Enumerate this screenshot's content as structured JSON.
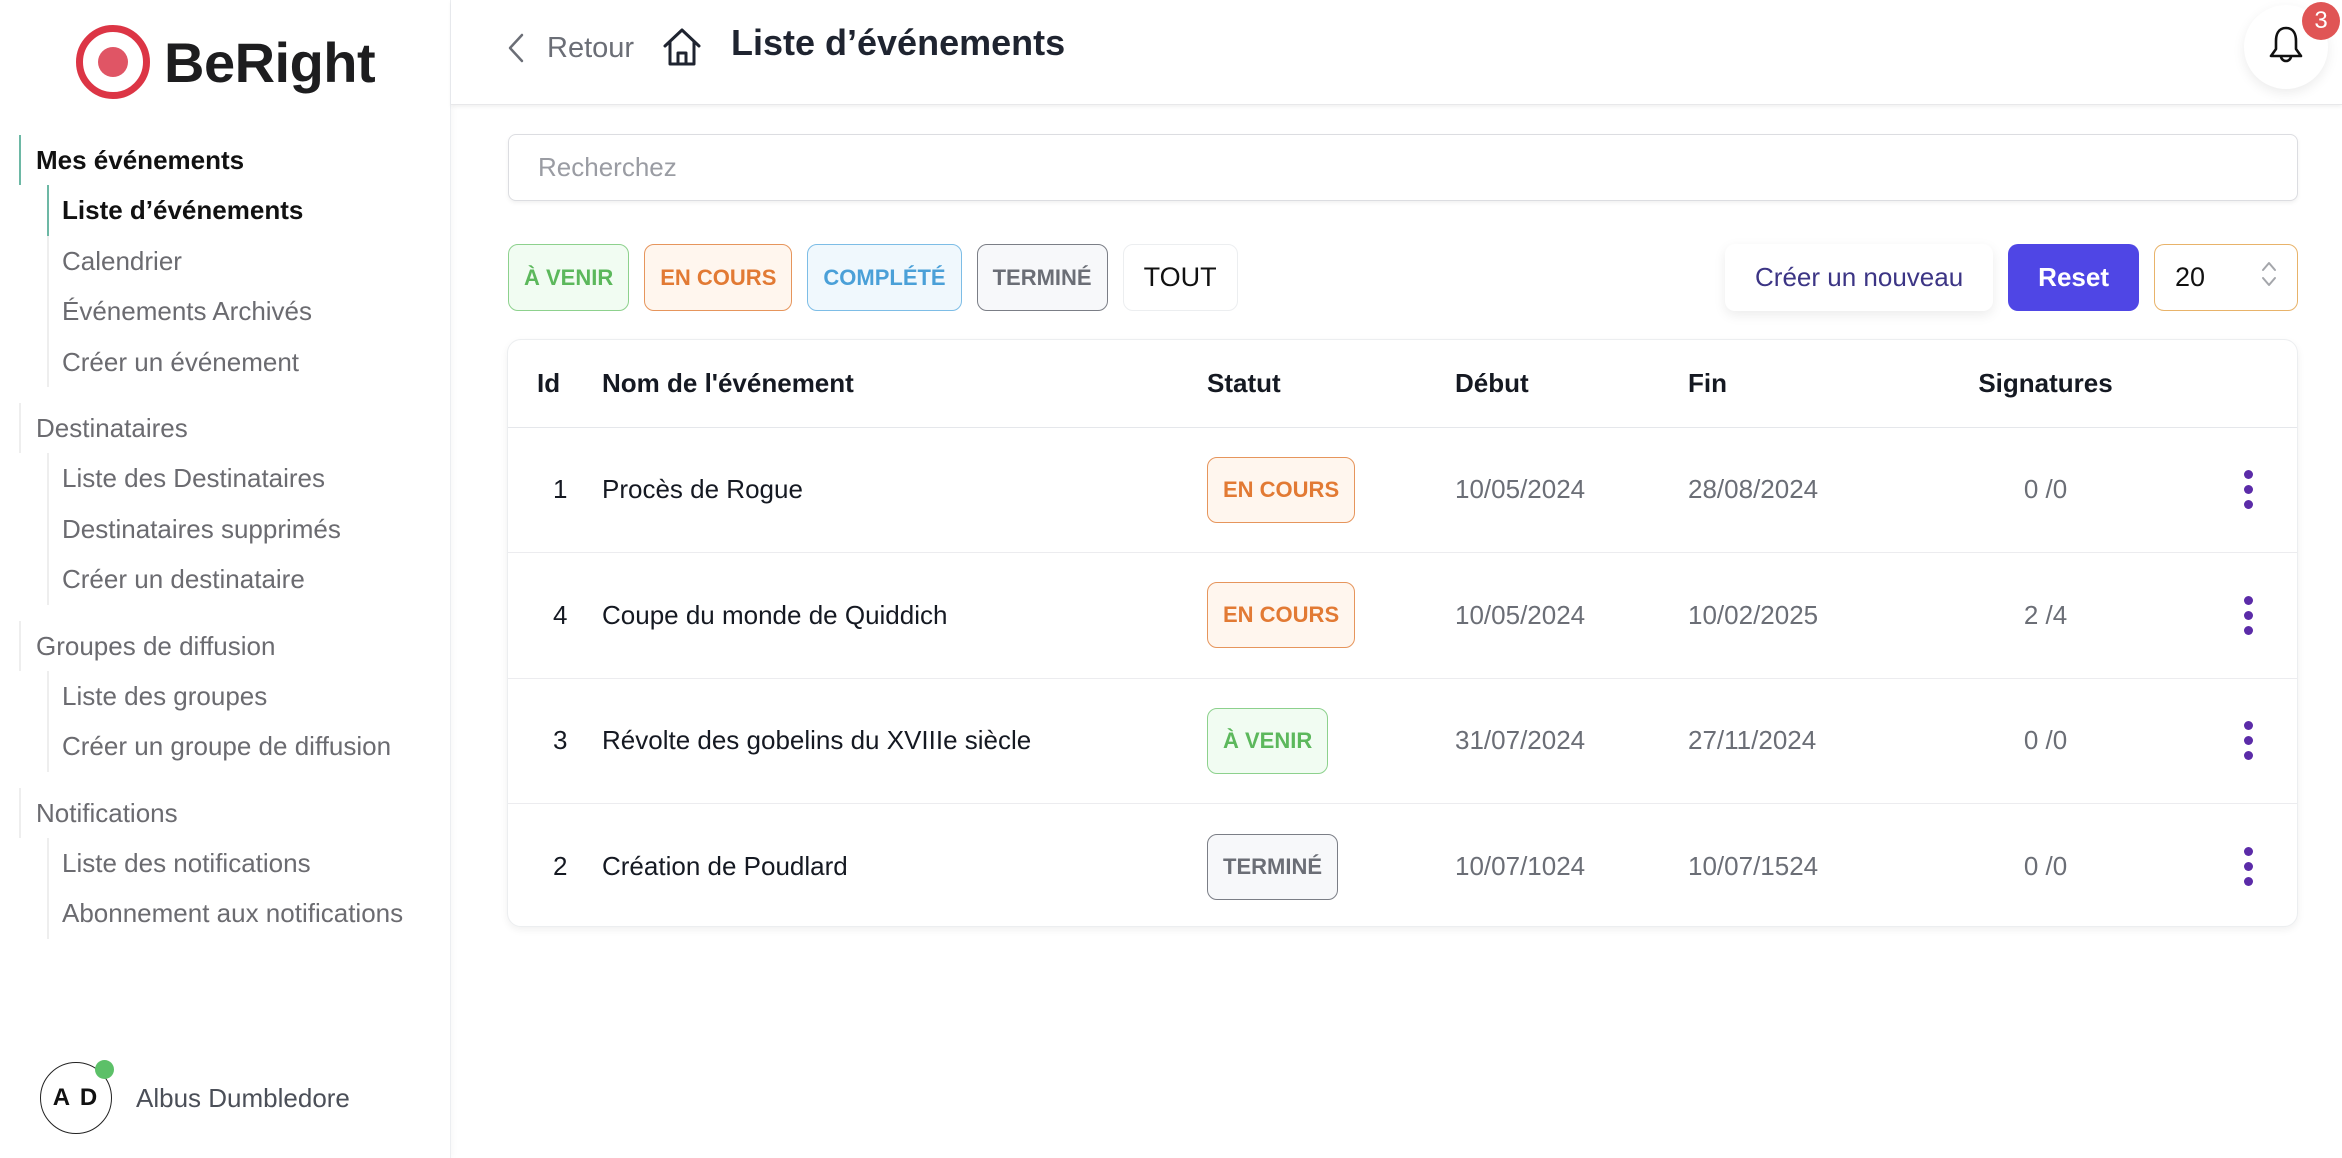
{
  "brand": {
    "name": "BeRight",
    "accent": "#dc3545"
  },
  "sidebar": {
    "groups": [
      {
        "title": "Mes événements",
        "active": true,
        "items": [
          {
            "label": "Liste d’événements",
            "active": true
          },
          {
            "label": "Calendrier"
          },
          {
            "label": "Événements Archivés"
          },
          {
            "label": "Créer un événement"
          }
        ]
      },
      {
        "title": "Destinataires",
        "items": [
          {
            "label": "Liste des Destinataires"
          },
          {
            "label": "Destinataires supprimés"
          },
          {
            "label": "Créer un destinataire"
          }
        ]
      },
      {
        "title": "Groupes de diffusion",
        "items": [
          {
            "label": "Liste des groupes"
          },
          {
            "label": "Créer un groupe de diffusion"
          }
        ]
      },
      {
        "title": "Notifications",
        "items": [
          {
            "label": "Liste des notifications"
          },
          {
            "label": "Abonnement aux notifications"
          }
        ]
      }
    ],
    "user": {
      "initials": "A D",
      "name": "Albus Dumbledore",
      "status_color": "#5cc068"
    }
  },
  "header": {
    "back_label": "Retour",
    "title": "Liste d’événements",
    "notification_count": "3"
  },
  "search": {
    "placeholder": "Recherchez",
    "value": ""
  },
  "filters": [
    {
      "label": "À VENIR",
      "variant": "green"
    },
    {
      "label": "EN COURS",
      "variant": "orange"
    },
    {
      "label": "COMPLÉTÉ",
      "variant": "blue"
    },
    {
      "label": "TERMINÉ",
      "variant": "grey"
    },
    {
      "label": "TOUT",
      "variant": "all"
    }
  ],
  "actions": {
    "create_label": "Créer un nouveau",
    "reset_label": "Reset",
    "page_size": "20",
    "reset_color": "#4f46e5"
  },
  "table": {
    "columns": [
      "Id",
      "Nom de l'événement",
      "Statut",
      "Début",
      "Fin",
      "Signatures"
    ],
    "rows": [
      {
        "id": "1",
        "name": "Procès de Rogue",
        "status": "EN COURS",
        "status_type": "ongoing",
        "start": "10/05/2024",
        "end": "28/08/2024",
        "signatures": "0 /0"
      },
      {
        "id": "4",
        "name": "Coupe du monde de Quiddich",
        "status": "EN COURS",
        "status_type": "ongoing",
        "start": "10/05/2024",
        "end": "10/02/2025",
        "signatures": "2 /4"
      },
      {
        "id": "3",
        "name": "Révolte des gobelins du XVIIIe siècle",
        "status": "À VENIR",
        "status_type": "upcoming",
        "start": "31/07/2024",
        "end": "27/11/2024",
        "signatures": "0 /0"
      },
      {
        "id": "2",
        "name": "Création de Poudlard",
        "status": "TERMINÉ",
        "status_type": "done",
        "start": "10/07/1024",
        "end": "10/07/1524",
        "signatures": "0 /0"
      }
    ]
  }
}
